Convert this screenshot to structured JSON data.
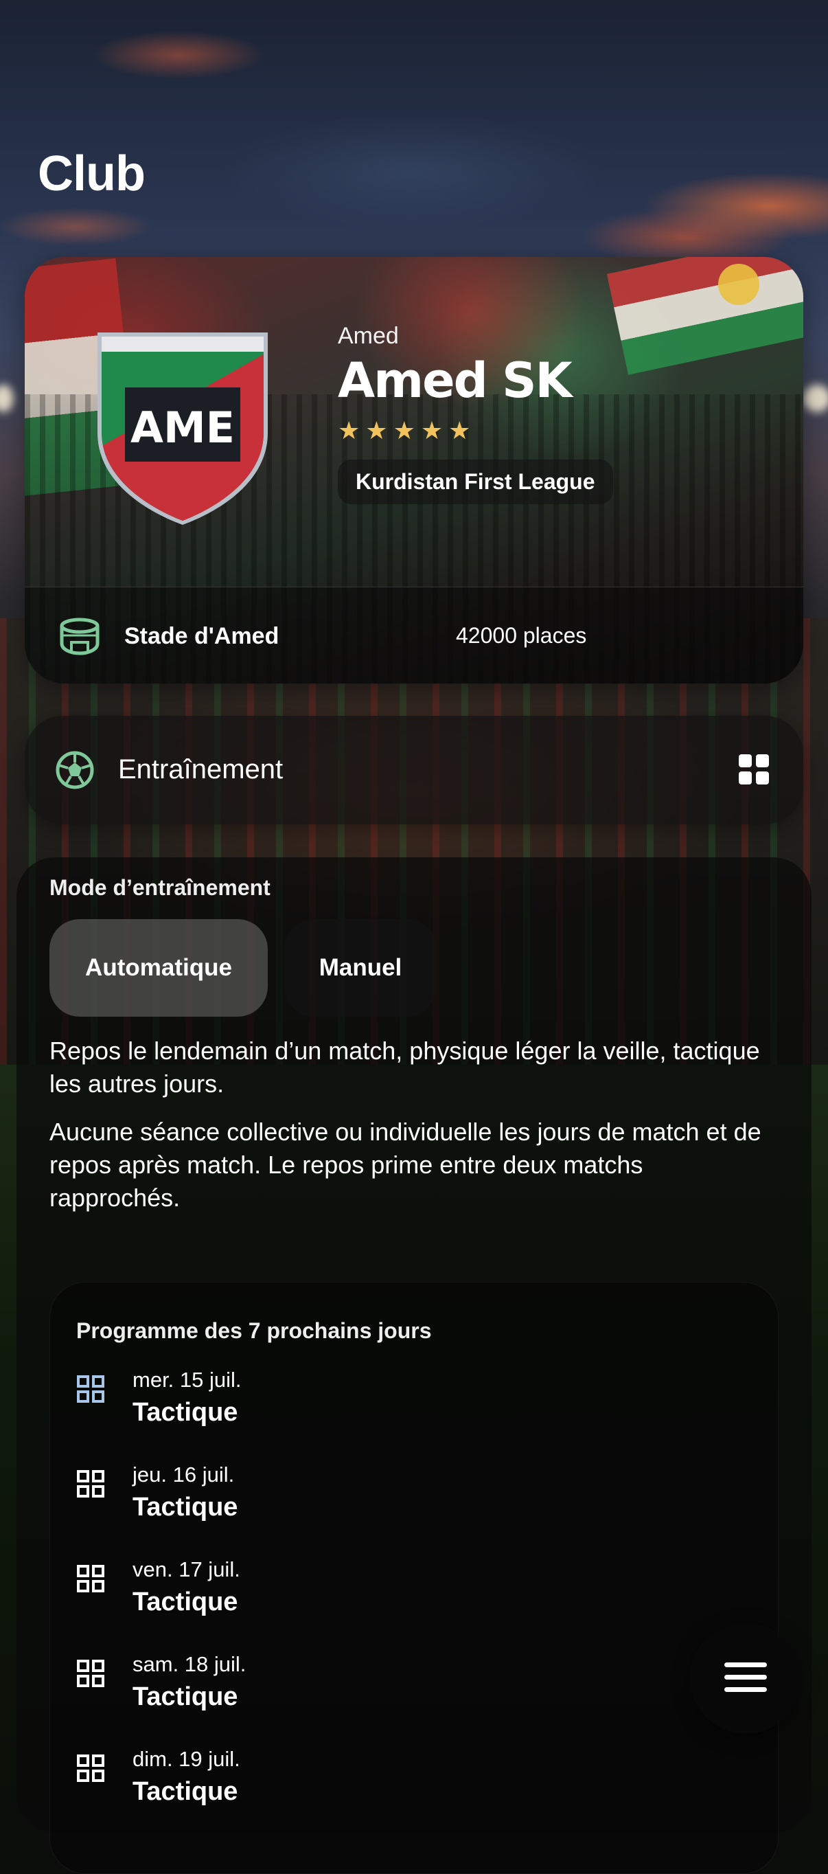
{
  "page": {
    "title": "Club"
  },
  "club": {
    "crest_text": "AME",
    "city": "Amed",
    "name": "Amed SK",
    "stars": 5,
    "league": "Kurdistan First League",
    "stadium": {
      "name": "Stade d'Amed",
      "capacity": "42000 places"
    }
  },
  "training": {
    "title": "Entraînement",
    "mode_label": "Mode d’entraînement",
    "modes": [
      {
        "label": "Automatique",
        "selected": true
      },
      {
        "label": "Manuel",
        "selected": false
      }
    ],
    "description_1": "Repos le lendemain d’un match, physique léger la veille, tactique les autres jours.",
    "description_2": "Aucune séance collective ou individuelle les jours de match et de repos après match. Le repos prime entre deux matchs rapprochés."
  },
  "schedule": {
    "title": "Programme des 7 prochains jours",
    "days": [
      {
        "date": "mer. 15 juil.",
        "type": "Tactique"
      },
      {
        "date": "jeu. 16 juil.",
        "type": "Tactique"
      },
      {
        "date": "ven. 17 juil.",
        "type": "Tactique"
      },
      {
        "date": "sam. 18 juil.",
        "type": "Tactique"
      },
      {
        "date": "dim. 19 juil.",
        "type": "Tactique"
      }
    ]
  },
  "colors": {
    "accent_green": "#7fc89a",
    "star_gold": "#f2c25c",
    "crest_red": "#c8313a",
    "crest_green": "#1f8a4c",
    "crest_dark": "#1b1e24",
    "schedule_icon_first": "#a8c6ea",
    "schedule_icon": "#ffffff"
  },
  "icons": {
    "stadium": "stadium-icon",
    "training": "soccer-ball-icon",
    "view_toggle": "grid-icon",
    "schedule_day": "grid-icon",
    "menu": "hamburger-menu-icon"
  }
}
